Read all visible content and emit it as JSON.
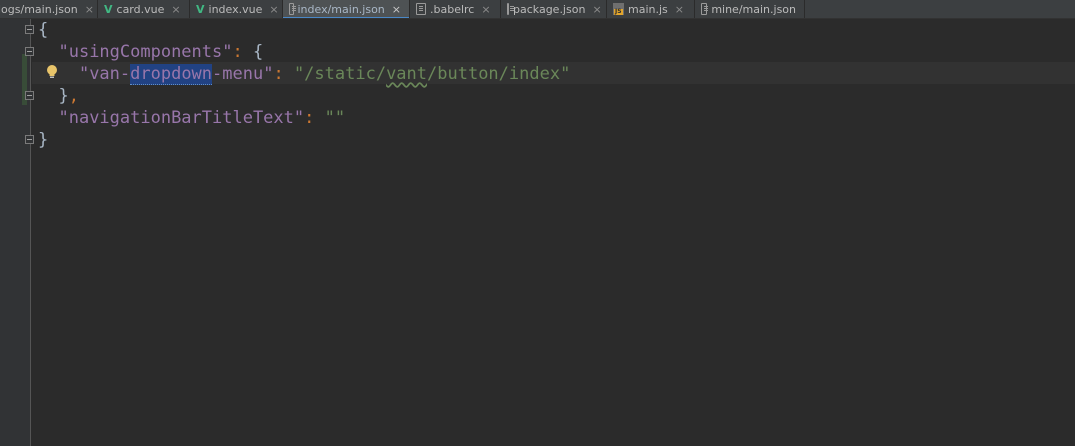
{
  "tabs": [
    {
      "label": "logs/main.json",
      "icon": "json-file-icon",
      "active": false
    },
    {
      "label": "card.vue",
      "icon": "vue-file-icon",
      "active": false
    },
    {
      "label": "index.vue",
      "icon": "vue-file-icon",
      "active": false
    },
    {
      "label": "index/main.json",
      "icon": "json-file-icon",
      "active": true
    },
    {
      "label": ".babelrc",
      "icon": "json-file-icon",
      "active": false
    },
    {
      "label": "package.json",
      "icon": "json-file-icon",
      "active": false
    },
    {
      "label": "main.js",
      "icon": "js-file-icon",
      "active": false
    },
    {
      "label": "mine/main.json",
      "icon": "json-file-icon",
      "active": false
    }
  ],
  "close_glyph": "×",
  "editor": {
    "line1": {
      "brace": "{"
    },
    "line2": {
      "key": "\"usingComponents\"",
      "colon": ": ",
      "brace": "{"
    },
    "line3": {
      "key_part1": "\"van-",
      "key_selected": "dropdown",
      "key_part2": "-menu\"",
      "colon": ": ",
      "value_part1": "\"/static/",
      "value_squiggle": "vant",
      "value_part2": "/button/index\""
    },
    "line4": {
      "brace": "}",
      "comma": ","
    },
    "line5": {
      "key": "\"navigationBarTitleText\"",
      "colon": ": ",
      "value": "\"\""
    },
    "line6": {
      "brace": "}"
    }
  },
  "colors": {
    "background": "#2b2b2b",
    "key": "#9876aa",
    "string": "#6a8759",
    "punctuation": "#cc7832",
    "selection": "#214283",
    "active_tab_underline": "#4a88c7"
  },
  "intention_icon": "lightbulb-icon"
}
